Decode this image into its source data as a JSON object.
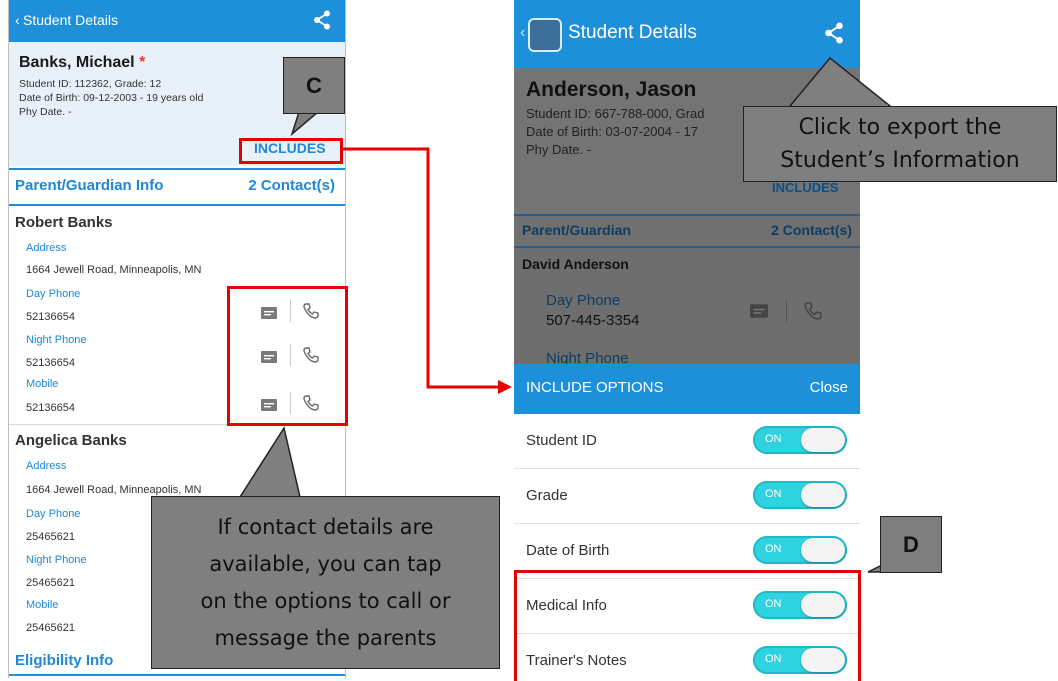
{
  "left_screen": {
    "appbar": {
      "back_label": "‹",
      "title": "Student Details",
      "share_icon": "share-icon"
    },
    "student": {
      "name": "Banks, Michael",
      "required_mark": "*",
      "id_line": "Student ID: 112362, Grade: 12",
      "dob_line": "Date of Birth: 09-12-2003 - 19 years old",
      "phy_line": "Phy Date. -",
      "includes_label": "INCLUDES"
    },
    "section": {
      "title": "Parent/Guardian Info",
      "count": "2 Contact(s)"
    },
    "contacts": [
      {
        "name": "Robert Banks",
        "address_label": "Address",
        "address": "1664 Jewell Road, Minneapolis, MN",
        "day_label": "Day Phone",
        "day": "52136654",
        "night_label": "Night Phone",
        "night": "52136654",
        "mobile_label": "Mobile",
        "mobile": "52136654"
      },
      {
        "name": "Angelica Banks",
        "address_label": "Address",
        "address": "1664 Jewell Road, Minneapolis, MN",
        "day_label": "Day Phone",
        "day": "25465621",
        "night_label": "Night Phone",
        "night": "25465621",
        "mobile_label": "Mobile",
        "mobile": "25465621"
      }
    ],
    "eligibility": "Eligibility Info"
  },
  "right_screen": {
    "appbar": {
      "back_label": "‹",
      "title": "Student Details",
      "share_icon": "share-icon"
    },
    "student": {
      "name": "Anderson, Jason",
      "id_line": "Student ID: 667-788-000, Grad",
      "dob_line": "Date of Birth: 03-07-2004 - 17",
      "phy_line": "Phy Date. -",
      "includes_label": "INCLUDES"
    },
    "section": {
      "title": "Parent/Guardian",
      "count": "2 Contact(s)"
    },
    "contact": {
      "name": "David Anderson",
      "day_label": "Day Phone",
      "day": "507-445-3354",
      "night_label": "Night Phone"
    },
    "sheet": {
      "title": "INCLUDE OPTIONS",
      "close_label": "Close",
      "toggle_text": "ON",
      "options": [
        {
          "label": "Student ID",
          "on": true
        },
        {
          "label": "Grade",
          "on": true
        },
        {
          "label": "Date of Birth",
          "on": true
        },
        {
          "label": "Medical Info",
          "on": true
        },
        {
          "label": "Trainer's Notes",
          "on": true
        }
      ]
    }
  },
  "annotations": {
    "callout_c": "C",
    "callout_d": "D",
    "export_note": "Click to export the Student’s Information",
    "export_note_line1": "Click to export the",
    "export_note_line2": "Student’s Information",
    "contact_note_lines": [
      "If contact details are",
      "available, you can tap",
      "on the options to call or",
      "message the parents"
    ]
  },
  "colors": {
    "app_blue": "#1e8fd9",
    "highlight_red": "#e60000",
    "callout_gray": "#7f7f7f",
    "toggle_cyan": "#2fd3e0"
  }
}
